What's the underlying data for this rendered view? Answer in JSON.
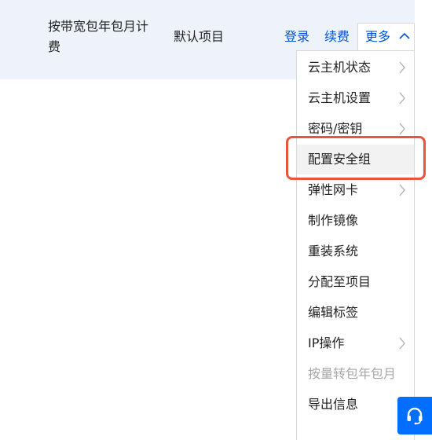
{
  "row": {
    "billing_mode": "按带宽包年包月计费",
    "project": "默认项目",
    "actions": {
      "login": "登录",
      "renew": "续费",
      "more": "更多"
    }
  },
  "more_menu": {
    "items": [
      {
        "label": "云主机状态",
        "has_submenu": true
      },
      {
        "label": "云主机设置",
        "has_submenu": true
      },
      {
        "label": "密码/密钥",
        "has_submenu": true
      },
      {
        "label": "配置安全组",
        "has_submenu": false,
        "highlighted": true
      },
      {
        "label": "弹性网卡",
        "has_submenu": true
      },
      {
        "label": "制作镜像",
        "has_submenu": false
      },
      {
        "label": "重装系统",
        "has_submenu": false
      },
      {
        "label": "分配至项目",
        "has_submenu": false
      },
      {
        "label": "编辑标签",
        "has_submenu": false
      },
      {
        "label": "IP操作",
        "has_submenu": true
      },
      {
        "label": "按量转包年包月",
        "has_submenu": false,
        "disabled": true
      },
      {
        "label": "导出信息",
        "has_submenu": false
      }
    ]
  },
  "icons": {
    "more_toggle": "chevron-up-icon",
    "submenu_arrow": "chevron-right-icon",
    "support": "headset-icon"
  },
  "colors": {
    "link": "#0052d9",
    "row_background": "#eef3fb",
    "hover_background": "#f2f2f2",
    "annotation_border": "#e8553b",
    "support_button": "#006eff",
    "disabled_text": "#a7a7a7"
  }
}
